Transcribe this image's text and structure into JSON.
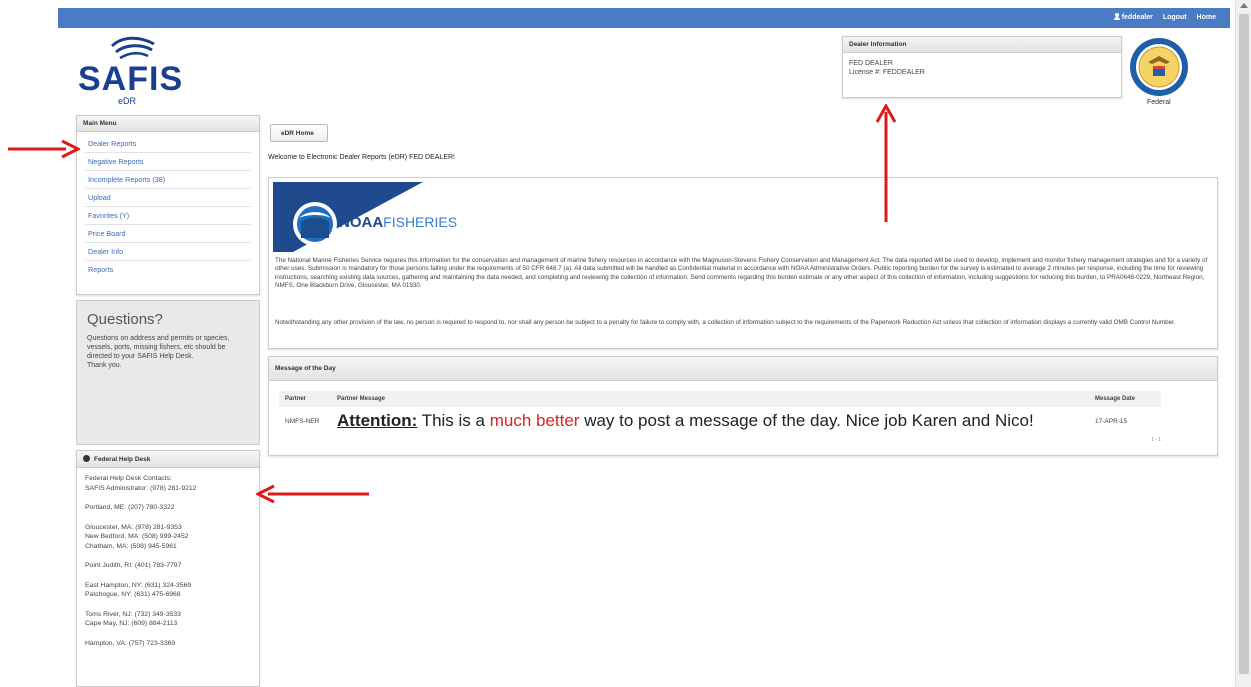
{
  "topbar": {
    "user": "feddealer",
    "logout": "Logout",
    "home": "Home"
  },
  "logo": {
    "name": "SAFIS",
    "sub": "eDR"
  },
  "dealer": {
    "title": "Dealer Information",
    "name": "FED DEALER",
    "license": "License #: FEDDEALER"
  },
  "seal": {
    "label": "Federal"
  },
  "menu": {
    "title": "Main Menu",
    "items": [
      "Dealer Reports",
      "Negative Reports",
      "Incomplete Reports (38)",
      "Upload",
      "Favorites (Y)",
      "Price Board",
      "Dealer Info",
      "Reports"
    ]
  },
  "questions": {
    "title": "Questions?",
    "body": "Questions on address and permits or species, vessels, ports, missing fishers, etc should be directed to your SAFIS Help Desk.",
    "thanks": "Thank you."
  },
  "help": {
    "title": "Federal Help Desk",
    "lines": [
      [
        "Federal Help Desk Contacts:",
        "SAFIS Administrator: (978) 281-9212"
      ],
      [
        "Portland, ME: (207) 780-3322"
      ],
      [
        "Gloucester, MA: (978) 281-9353",
        "New Bedford, MA: (508) 999-2452",
        "Chatham, MA: (508) 945-5961"
      ],
      [
        "Point Judith, RI: (401) 783-7797"
      ],
      [
        "East Hampton, NY: (631) 324-3569",
        "Patchogue, NY: (631) 475-6968"
      ],
      [
        "Toms River, NJ: (732) 349-3533",
        "Cape May, NJ: (609) 884-2113"
      ],
      [
        "Hampton, VA: (757) 723-3369"
      ]
    ]
  },
  "breadcrumb": "eDR Home",
  "welcome": "Welcome to Electronic Dealer Reports (eDR) FED DEALER!",
  "noaa": {
    "brand_bold": "NOAA",
    "brand_rest": "FISHERIES",
    "para1": "The National Marine Fisheries Service requires this information for the conservation and management of marine fishery resources in accordance with the Magnuson-Stevens Fishery Conservation and Management Act. The data reported will be used to develop, implement and monitor fishery management strategies and for a variety of other uses. Submission is mandatory for those persons falling under the requirements of 50 CFR 648.7 (a). All data submitted will be handled as Confidential material in accordance with NOAA Administrative Orders. Public reporting burden for the survey is estimated to average 2 minutes per response, including the time for reviewing instructions, searching existing data sources, gathering and maintaining the data needed, and completing and reviewing the collection of information. Send comments regarding this burden estimate or any other aspect of this collection of information, including suggestions for reducing this burden, to PRA0648-0229, Northeast Region, NMFS, One Blackburn Drive, Gloucester, MA 01930.",
    "para2": "Notwithstanding any other provision of the law, no person is required to respond to, nor shall any person be subject to a penalty for failure to comply with, a collection of information subject to the requirements of the Paperwork Reduction Act unless that collection of information displays a currently valid OMB Control Number."
  },
  "motd": {
    "title": "Message of the Day",
    "headers": [
      "Partner",
      "Partner Message",
      "Message Date"
    ],
    "row": {
      "partner": "NMFS-NER",
      "attention": "Attention:",
      "msg1": " This is a ",
      "highlight": "much better",
      "msg2": " way to post a message of the day. Nice job Karen and Nico!",
      "date": "17-APR-15"
    },
    "count": "1 - 1"
  },
  "colors": {
    "topbar": "#4a7bc4",
    "link": "#3a6bb8",
    "arrow": "#e01818",
    "highlight": "#e02020"
  }
}
